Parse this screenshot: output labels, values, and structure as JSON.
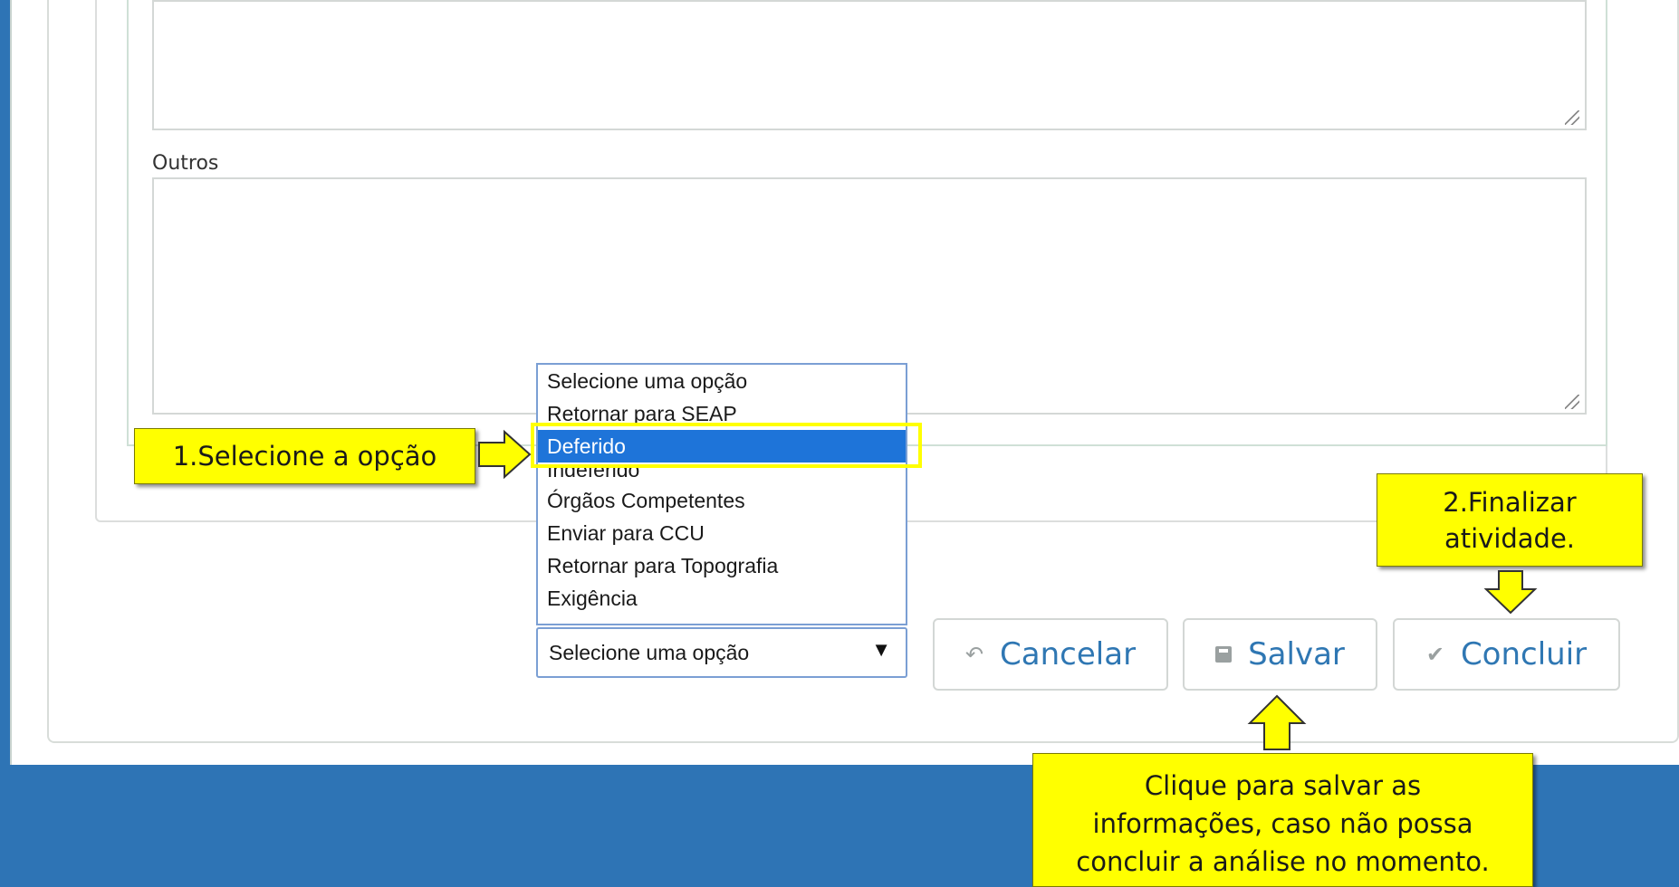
{
  "form": {
    "outros_label": "Outros"
  },
  "dropdown": {
    "options": [
      "Selecione uma opção",
      "Retornar para SEAP",
      "Deferido",
      "Indeferido",
      "Órgãos Competentes",
      "Enviar para CCU",
      "Retornar para Topografia",
      "Exigência"
    ],
    "selected_index": 2,
    "current_value": "Selecione uma opção",
    "arrow": "▼"
  },
  "buttons": {
    "cancel": "Cancelar",
    "save": "Salvar",
    "conclude": "Concluir"
  },
  "icons": {
    "cancel": "undo-icon",
    "save": "floppy-disk-icon",
    "conclude": "checkmark-icon"
  },
  "callouts": {
    "step1": "1.Selecione a opção",
    "step2_line1": "2.Finalizar",
    "step2_line2": "atividade.",
    "save_line1": "Clique para salvar as",
    "save_line2": "informações, caso não possa",
    "save_line3": "concluir a análise no momento."
  },
  "colors": {
    "background": "#2e74b5",
    "callout": "#ffff00",
    "selected_option": "#1e74d9",
    "button_text": "#2f77b3"
  }
}
